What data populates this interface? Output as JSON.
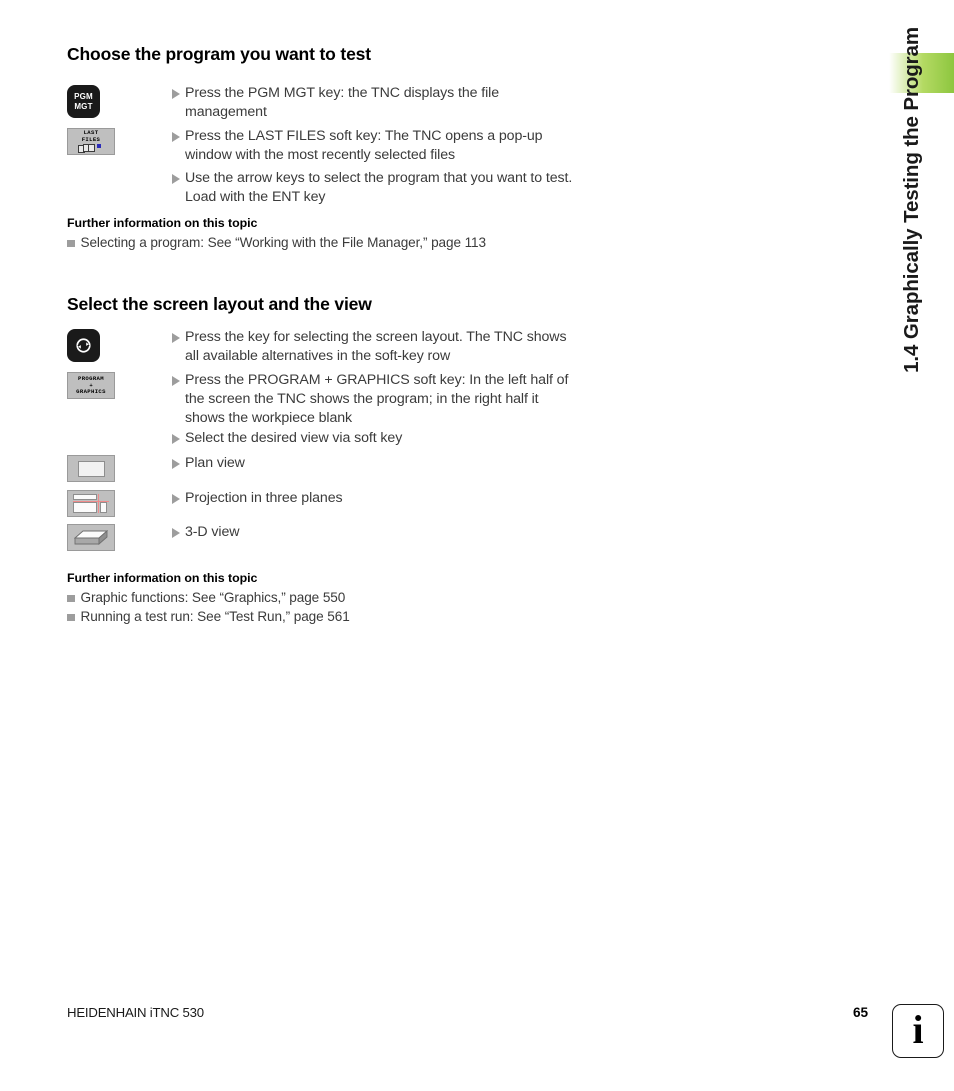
{
  "chapter_tab": {
    "title": "1.4 Graphically Testing the Program",
    "accent_color": "#8dc63f"
  },
  "sections": [
    {
      "heading": "Choose the program you want to test",
      "steps": [
        {
          "key": {
            "type": "hardware-key",
            "label_lines": [
              "PGM",
              "MGT"
            ],
            "icon": "pgm-mgt-key-icon"
          },
          "text": "Press the PGM MGT key: the TNC displays the file management"
        },
        {
          "key": {
            "type": "soft-key",
            "label_lines": [
              "LAST",
              "FILES"
            ],
            "icon": "last-files-softkey-icon"
          },
          "text": "Press the LAST FILES soft key: The TNC opens a pop-up window with the most recently selected files"
        },
        {
          "key": null,
          "text": "Use the arrow keys to select the program that you want to test. Load with the ENT key"
        }
      ],
      "further": {
        "title": "Further information on this topic",
        "items": [
          "Selecting a program: See “Working with the File Manager,” page 113"
        ]
      }
    },
    {
      "heading": "Select the screen layout and the view",
      "steps": [
        {
          "key": {
            "type": "hardware-key",
            "label_lines": [],
            "icon": "screen-layout-key-icon"
          },
          "text": "Press the key for selecting the screen layout. The TNC shows all available alternatives in the soft-key row"
        },
        {
          "key": {
            "type": "soft-key",
            "label_lines": [
              "PROGRAM",
              "+",
              "GRAPHICS"
            ],
            "icon": "program-graphics-softkey-icon"
          },
          "text": "Press the PROGRAM + GRAPHICS soft key: In the left half of the screen the TNC shows the program; in the right half it shows the workpiece blank"
        },
        {
          "key": null,
          "text": "Select the desired view via soft key"
        },
        {
          "key": {
            "type": "soft-key",
            "label_lines": [],
            "icon": "plan-view-softkey-icon"
          },
          "text": "Plan view"
        },
        {
          "key": {
            "type": "soft-key",
            "label_lines": [],
            "icon": "three-planes-softkey-icon"
          },
          "text": "Projection in three planes"
        },
        {
          "key": {
            "type": "soft-key",
            "label_lines": [],
            "icon": "three-d-view-softkey-icon"
          },
          "text": "3-D view"
        }
      ],
      "further": {
        "title": "Further information on this topic",
        "items": [
          "Graphic functions: See “Graphics,” page 550",
          "Running a test run: See “Test Run,” page 561"
        ]
      }
    }
  ],
  "footer": {
    "brand": "HEIDENHAIN iTNC 530",
    "page_number": "65",
    "info_glyph": "i"
  }
}
